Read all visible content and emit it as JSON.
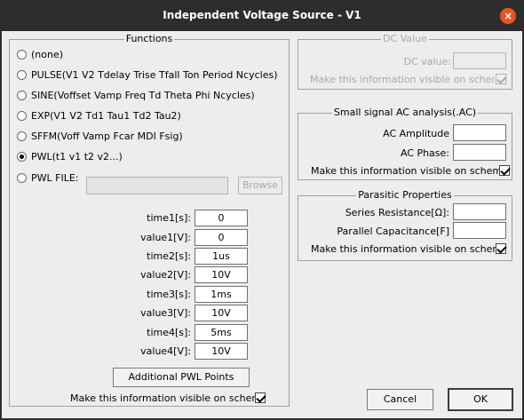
{
  "window": {
    "title": "Independent Voltage Source - V1",
    "close_glyph": "×"
  },
  "functions": {
    "title": "Functions",
    "options": [
      {
        "label": "(none)",
        "checked": false
      },
      {
        "label": "PULSE(V1 V2 Tdelay Trise Tfall Ton Period Ncycles)",
        "checked": false
      },
      {
        "label": "SINE(Voffset Vamp Freq Td Theta Phi Ncycles)",
        "checked": false
      },
      {
        "label": "EXP(V1 V2 Td1 Tau1 Td2 Tau2)",
        "checked": false
      },
      {
        "label": "SFFM(Voff Vamp Fcar MDI Fsig)",
        "checked": false
      },
      {
        "label": "PWL(t1 v1 t2 v2...)",
        "checked": true
      }
    ],
    "pwl_file": {
      "label": "PWL FILE:",
      "value": "",
      "browse_label": "Browse",
      "checked": false
    },
    "pwl_points": [
      {
        "label": "time1[s]:",
        "value": "0"
      },
      {
        "label": "value1[V]:",
        "value": "0"
      },
      {
        "label": "time2[s]:",
        "value": "1us"
      },
      {
        "label": "value2[V]:",
        "value": "10V"
      },
      {
        "label": "time3[s]:",
        "value": "1ms"
      },
      {
        "label": "value3[V]:",
        "value": "10V"
      },
      {
        "label": "time4[s]:",
        "value": "5ms"
      },
      {
        "label": "value4[V]:",
        "value": "10V"
      }
    ],
    "additional_button": "Additional PWL Points",
    "visible_label": "Make this information visible on schematic:",
    "visible_checked": true
  },
  "dc_value": {
    "title": "DC Value",
    "label": "DC value:",
    "value": "",
    "visible_label": "Make this information visible on schematic:",
    "visible_checked": true
  },
  "ac_analysis": {
    "title": "Small signal AC analysis(.AC)",
    "amplitude_label": "AC Amplitude",
    "amplitude_value": "",
    "phase_label": "AC Phase:",
    "phase_value": "",
    "visible_label": "Make this information visible on schematic:",
    "visible_checked": true
  },
  "parasitic": {
    "title": "Parasitic Properties",
    "series_label": "Series Resistance[Ω]:",
    "series_value": "",
    "parallel_label": "Parallel Capacitance[F]",
    "parallel_value": "",
    "visible_label": "Make this information visible on schematic:",
    "visible_checked": true
  },
  "buttons": {
    "cancel": "Cancel",
    "ok": "OK"
  }
}
